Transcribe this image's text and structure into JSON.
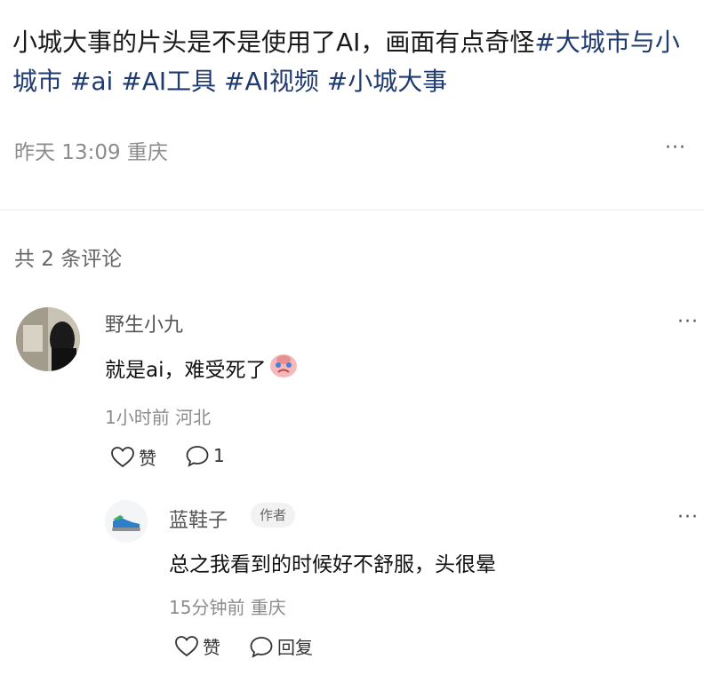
{
  "post": {
    "text": "小城大事的片头是不是使用了AI，画面有点奇怪",
    "tags": [
      "#大城市与小城市",
      "#ai",
      "#AI工具",
      "#AI视频",
      "#小城大事"
    ],
    "time": "昨天 13:09",
    "location": "重庆",
    "more": "···"
  },
  "comments_header": "共 2 条评论",
  "comments": [
    {
      "username": "野生小九",
      "text": "就是ai，难受死了",
      "emoji_icon": "crying-face-emoji",
      "time": "1小时前",
      "location": "河北",
      "like_label": "赞",
      "reply_count": "1",
      "more": "···"
    }
  ],
  "reply": {
    "username": "蓝鞋子",
    "badge": "作者",
    "text": "总之我看到的时候好不舒服，头很晕",
    "time": "15分钟前",
    "location": "重庆",
    "like_label": "赞",
    "reply_label": "回复",
    "more": "···"
  },
  "colors": {
    "tag": "#1f3a6e",
    "meta": "#8c8c8c",
    "divider": "#eeeeee"
  }
}
